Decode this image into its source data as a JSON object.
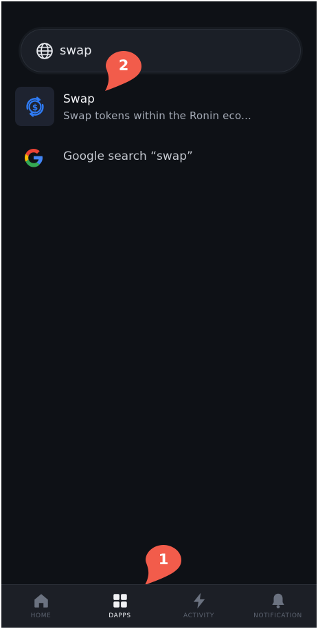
{
  "search": {
    "query": "swap",
    "icon": "globe-icon"
  },
  "results": [
    {
      "title": "Swap",
      "description": "Swap tokens within the Ronin eco...",
      "icon": "swap-dollar-icon"
    },
    {
      "label": "Google search “swap”",
      "icon": "google-icon"
    }
  ],
  "annotations": {
    "pin_1": "1",
    "pin_2": "2",
    "color": "#f25c4b"
  },
  "tabs": [
    {
      "label": "HOME",
      "icon": "home-icon",
      "active": false
    },
    {
      "label": "DAPPS",
      "icon": "grid-icon",
      "active": true
    },
    {
      "label": "ACTIVITY",
      "icon": "lightning-icon",
      "active": false
    },
    {
      "label": "NOTIFICATION",
      "icon": "bell-icon",
      "active": false
    }
  ],
  "colors": {
    "background": "#0e1116",
    "accent": "#2f7cf6",
    "active_tab": "#eef0f4",
    "inactive_tab": "#5c6370"
  }
}
